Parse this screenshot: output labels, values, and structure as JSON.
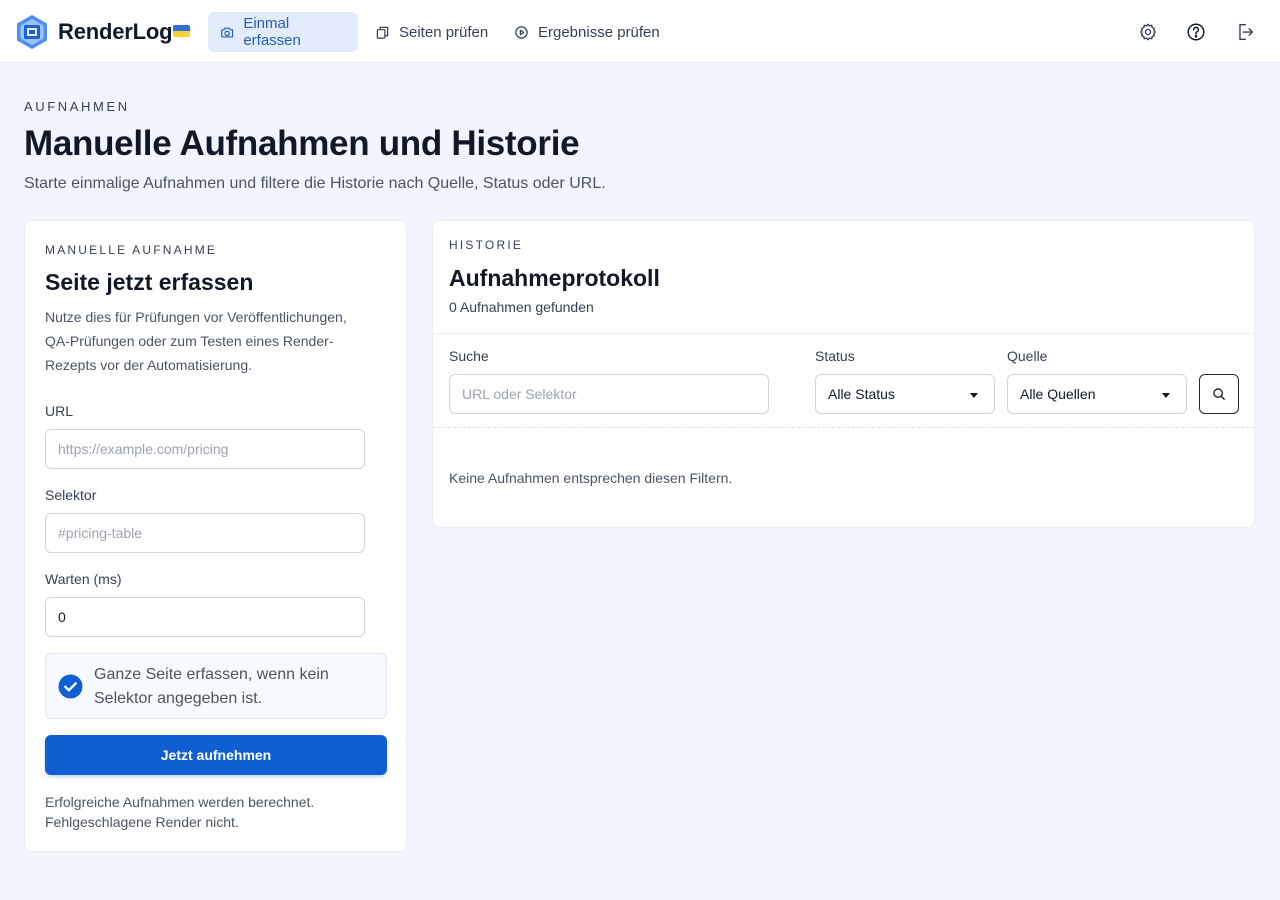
{
  "app": {
    "brand": "RenderLog",
    "colors": {
      "accent": "#0f5fd3",
      "activeNavBg": "#e2ecfb",
      "pageBg": "#f1f5fd"
    }
  },
  "nav": {
    "items": [
      {
        "label": "Einmal erfassen",
        "icon": "camera-icon",
        "active": true
      },
      {
        "label": "Seiten prüfen",
        "icon": "copy-icon",
        "active": false
      },
      {
        "label": "Ergebnisse prüfen",
        "icon": "play-circle-icon",
        "active": false
      }
    ],
    "actions": [
      "gear-icon",
      "help-circle-icon",
      "logout-icon"
    ]
  },
  "header": {
    "eyebrow": "AUFNAHMEN",
    "title": "Manuelle Aufnahmen und Historie",
    "subtitle": "Starte einmalige Aufnahmen und filtere die Historie nach Quelle, Status oder URL."
  },
  "manual": {
    "eyebrow": "MANUELLE AUFNAHME",
    "title": "Seite jetzt erfassen",
    "description": "Nutze dies für Prüfungen vor Veröffentlichungen, QA-Prüfungen oder zum Testen eines Render-Rezepts vor der Automatisierung.",
    "url_label": "URL",
    "url_placeholder": "https://example.com/pricing",
    "selector_label": "Selektor",
    "selector_placeholder": "#pricing-table",
    "wait_label": "Warten (ms)",
    "wait_value": "0",
    "fullpage_checked": true,
    "fullpage_label": "Ganze Seite erfassen, wenn kein Selektor angegeben ist.",
    "submit_label": "Jetzt aufnehmen",
    "note": "Erfolgreiche Aufnahmen werden berechnet. Fehlgeschlagene Render nicht."
  },
  "history": {
    "eyebrow": "HISTORIE",
    "title": "Aufnahmeprotokoll",
    "count": "0 Aufnahmen gefunden",
    "search_label": "Suche",
    "search_placeholder": "URL oder Selektor",
    "status_label": "Status",
    "status_value": "Alle Status",
    "source_label": "Quelle",
    "source_value": "Alle Quellen",
    "empty": "Keine Aufnahmen entsprechen diesen Filtern."
  }
}
